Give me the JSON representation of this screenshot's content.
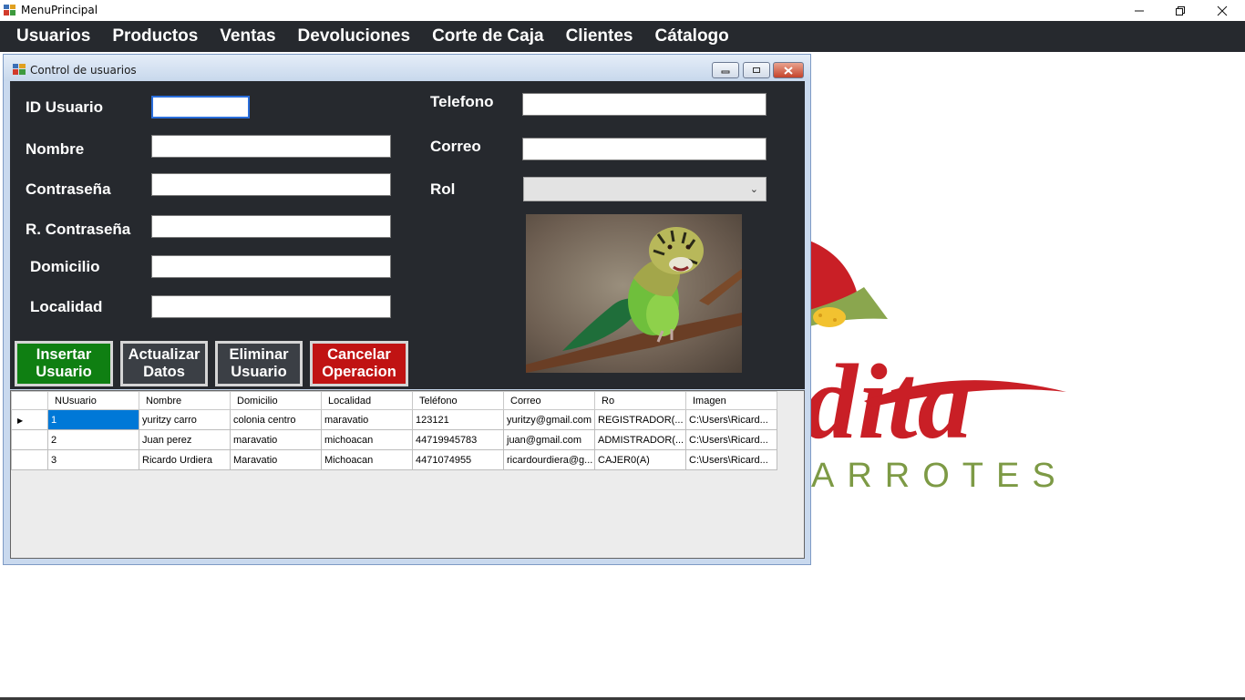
{
  "window": {
    "title": "MenuPrincipal",
    "minimize_icon": "minimize-icon",
    "restore_icon": "restore-icon",
    "close_icon": "close-icon"
  },
  "menu": {
    "items": [
      "Usuarios",
      "Productos",
      "Ventas",
      "Devoluciones",
      "Corte de Caja",
      "Clientes",
      "Cátalogo"
    ]
  },
  "background_logo": {
    "text_main": "dita",
    "text_sub": "ARROTES",
    "colors": {
      "red": "#c91f26",
      "green": "#7d9a45"
    }
  },
  "child_window": {
    "title": "Control de usuarios"
  },
  "form": {
    "labels": {
      "id": "ID Usuario",
      "nombre": "Nombre",
      "password": "Contraseña",
      "repeat_password": "R. Contraseña",
      "domicilio": "Domicilio",
      "localidad": "Localidad",
      "telefono": "Telefono",
      "correo": "Correo",
      "rol": "Rol"
    },
    "values": {
      "id": "",
      "nombre": "",
      "password": "",
      "repeat_password": "",
      "domicilio": "",
      "localidad": "",
      "telefono": "",
      "correo": "",
      "rol": ""
    }
  },
  "buttons": {
    "insert_line1": "Insertar",
    "insert_line2": "Usuario",
    "update_line1": "Actualizar",
    "update_line2": "Datos",
    "delete_line1": "Eliminar",
    "delete_line2": "Usuario",
    "cancel_line1": "Cancelar",
    "cancel_line2": "Operacion"
  },
  "colors": {
    "panel": "#26292e",
    "insert_btn": "#0f7f12",
    "neutral_btn": "#3b3f45",
    "cancel_btn": "#c01313",
    "selection": "#0078d7"
  },
  "grid": {
    "columns": [
      "NUsuario",
      "Nombre",
      "Domicilio",
      "Localidad",
      "Teléfono",
      "Correo",
      "Ro",
      "Imagen"
    ],
    "rows": [
      [
        "1",
        "yuritzy carro",
        "colonia centro",
        "maravatio",
        "123121",
        "yuritzy@gmail.com",
        "REGISTRADOR(...",
        "C:\\Users\\Ricard..."
      ],
      [
        "2",
        "Juan perez",
        "maravatio",
        "michoacan",
        "44719945783",
        "juan@gmail.com",
        "ADMISTRADOR(...",
        "C:\\Users\\Ricard..."
      ],
      [
        "3",
        "Ricardo Urdiera",
        "Maravatio",
        "Michoacan",
        "4471074955",
        "ricardourdiera@g...",
        "CAJER0(A)",
        "C:\\Users\\Ricard..."
      ]
    ],
    "current_row_marker": "▶"
  }
}
